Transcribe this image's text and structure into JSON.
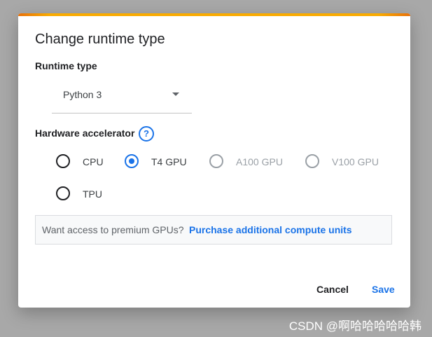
{
  "dialog": {
    "title": "Change runtime type",
    "runtime_type": {
      "label": "Runtime type",
      "selected": "Python 3"
    },
    "hardware_accelerator": {
      "label": "Hardware accelerator",
      "help_icon": "help-circle-icon",
      "options": [
        {
          "label": "CPU",
          "checked": false,
          "disabled": false
        },
        {
          "label": "T4 GPU",
          "checked": true,
          "disabled": false
        },
        {
          "label": "A100 GPU",
          "checked": false,
          "disabled": true
        },
        {
          "label": "V100 GPU",
          "checked": false,
          "disabled": true
        },
        {
          "label": "TPU",
          "checked": false,
          "disabled": false
        }
      ]
    },
    "promo": {
      "text": "Want access to premium GPUs?",
      "link": "Purchase additional compute units"
    },
    "buttons": {
      "cancel": "Cancel",
      "save": "Save"
    }
  },
  "watermark": "CSDN @啊哈哈哈哈哈韩",
  "colors": {
    "accent": "#1a73e8",
    "top_bar": "#f9ab00",
    "backdrop": "#a8a8a8"
  }
}
